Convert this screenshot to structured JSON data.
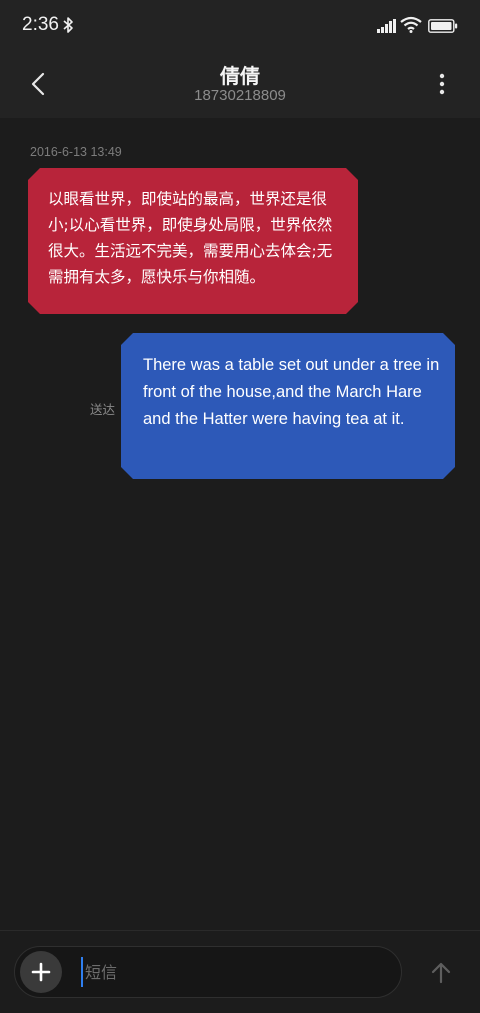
{
  "status_bar": {
    "time": "2:36"
  },
  "header": {
    "contact_name": "倩倩",
    "contact_number": "18730218809"
  },
  "conversation": {
    "timestamp": "2016-6-13 13:49",
    "incoming": {
      "text": "以眼看世界，即使站的最高，世界还是很小;以心看世界，即使身处局限，世界依然很大。生活远不完美，需要用心去体会;无需拥有太多，愿快乐与你相随。",
      "color": "#b8243a"
    },
    "outgoing": {
      "text": "There was a table set out under a tree in front of the house,and the March Hare and the Hatter were having tea at it.",
      "status": "送达",
      "color": "#2d59b8"
    }
  },
  "composer": {
    "placeholder": "短信",
    "value": ""
  },
  "icons": {
    "back": "chevron-left-icon",
    "more": "more-vertical-icon",
    "add": "plus-icon",
    "send": "arrow-up-icon",
    "bluetooth": "bluetooth-icon",
    "signal": "signal-icon",
    "wifi": "wifi-icon",
    "battery": "battery-icon"
  }
}
